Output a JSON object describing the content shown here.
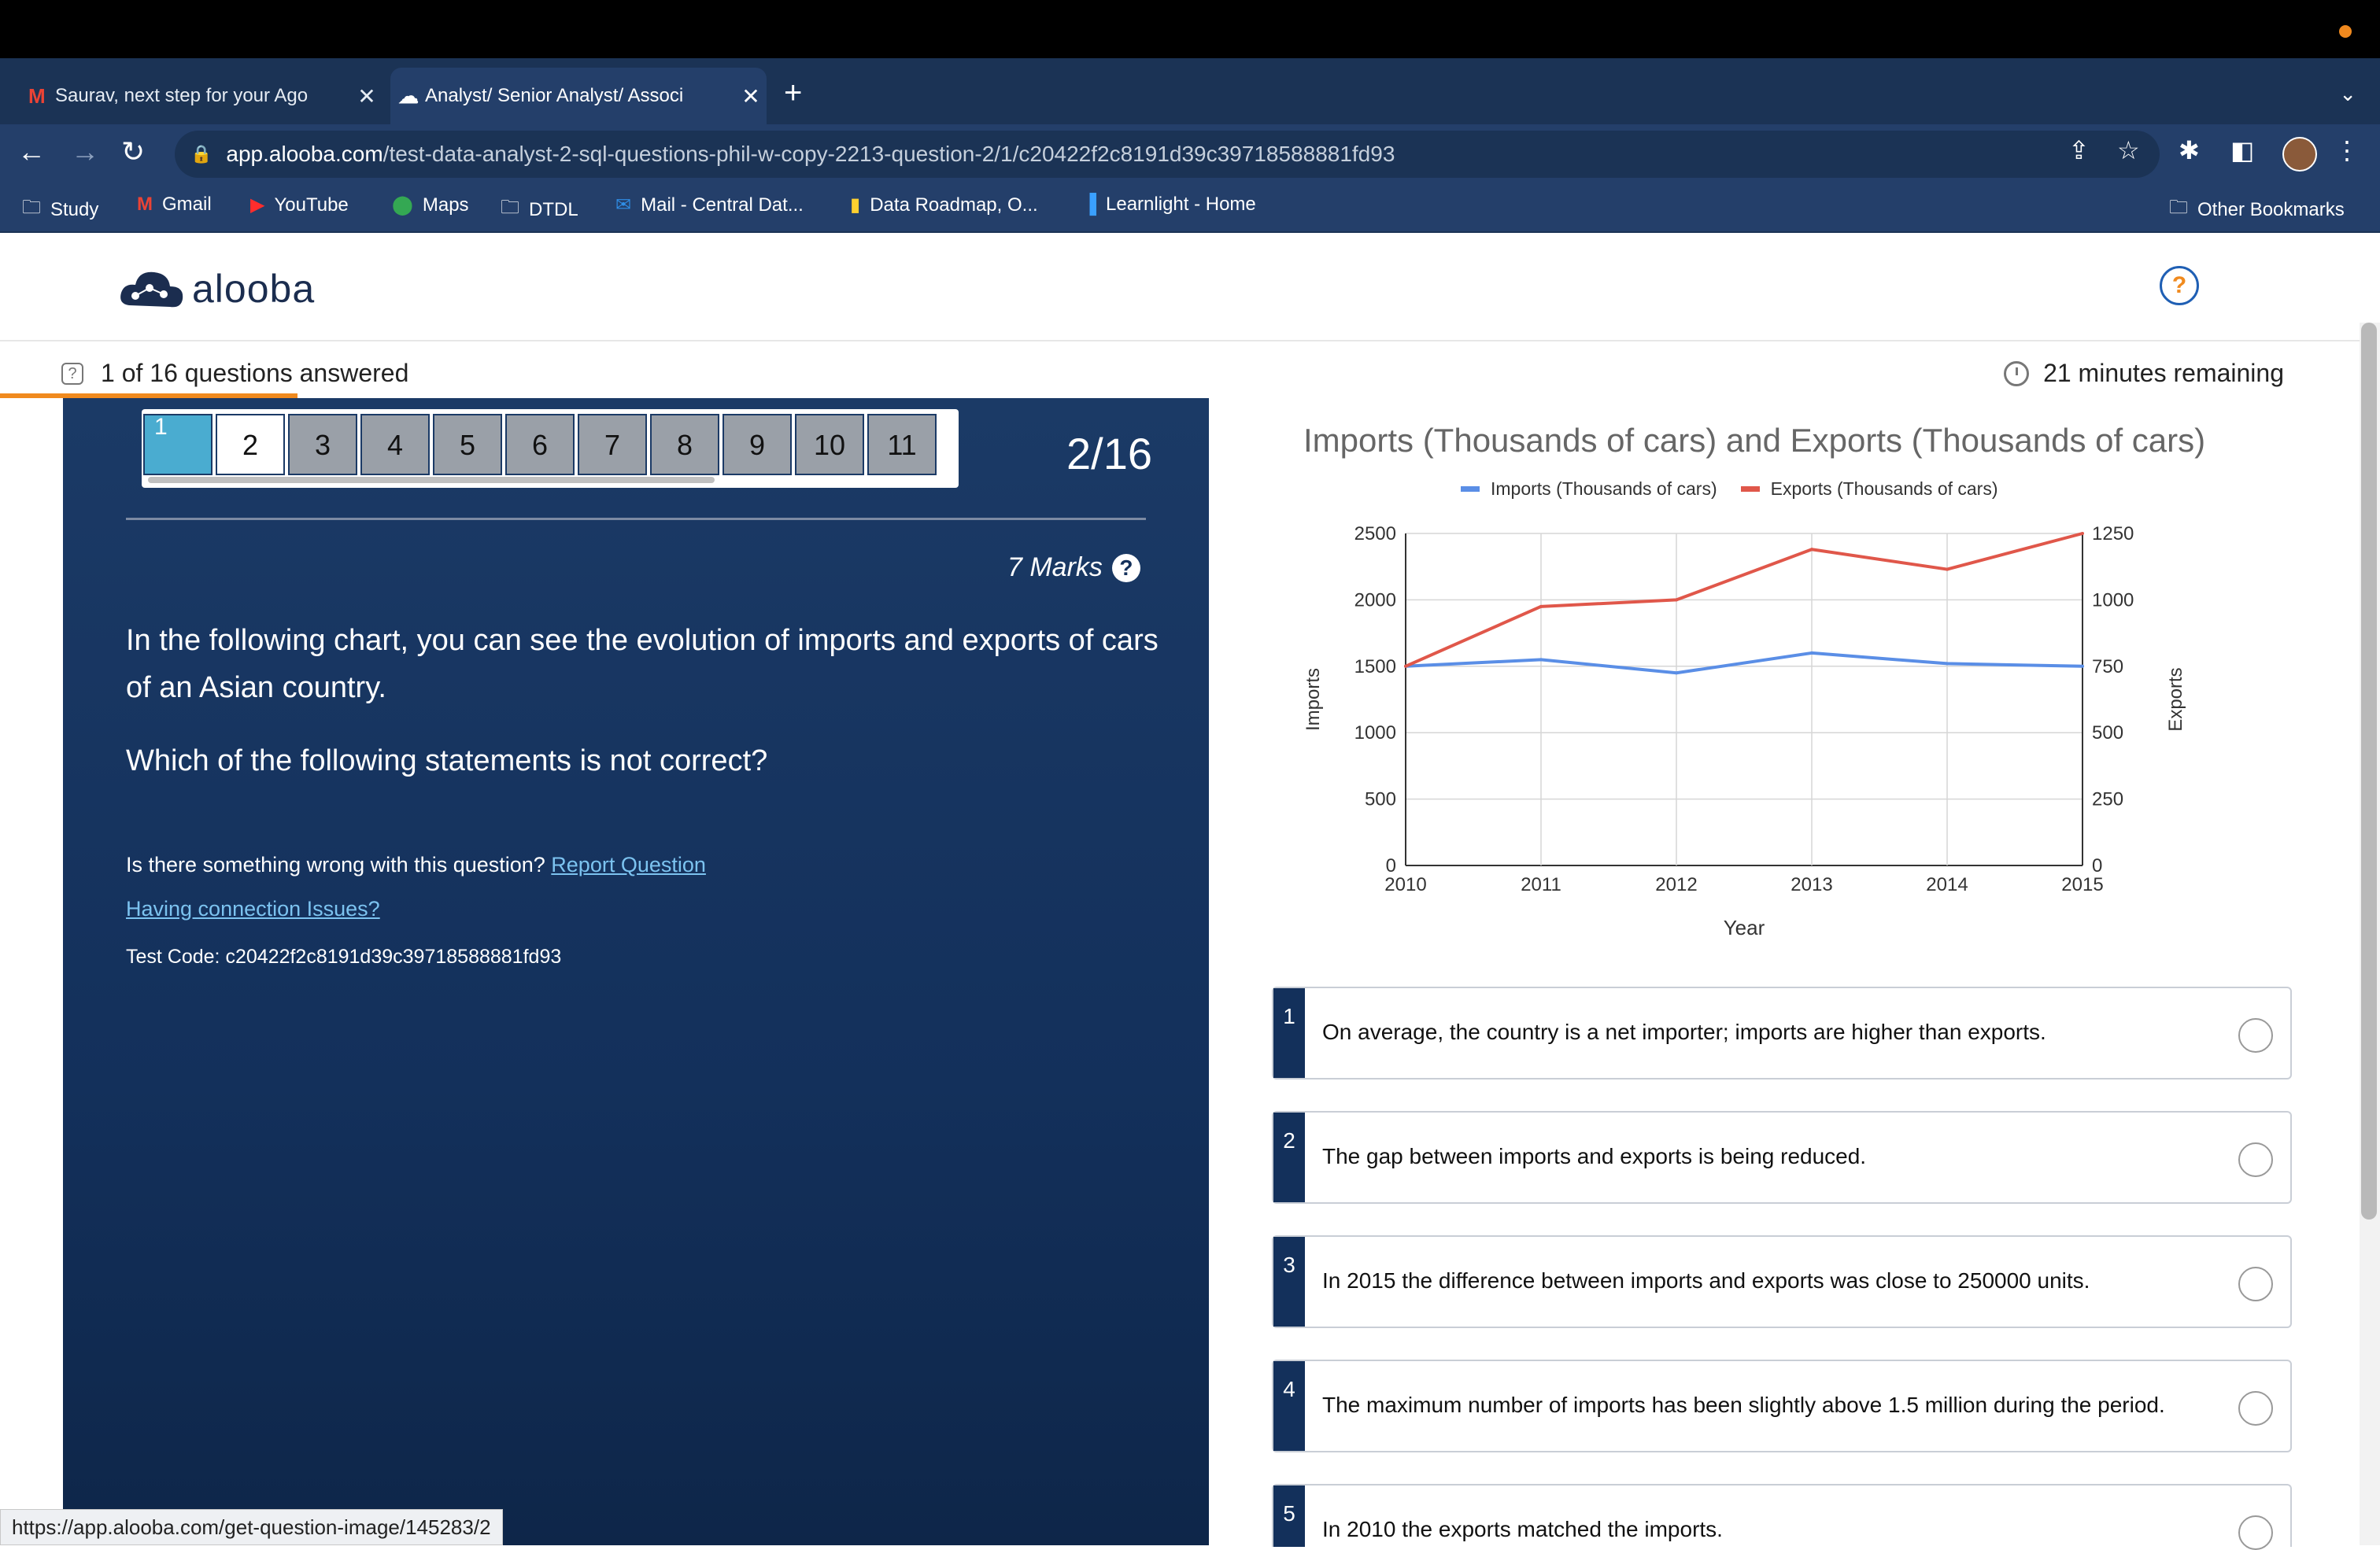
{
  "browser": {
    "tabs": [
      {
        "label": "Saurav, next step for your Ago",
        "icon": "gmail-icon"
      },
      {
        "label": "Analyst/ Senior Analyst/ Associ",
        "icon": "alooba-icon"
      }
    ],
    "url_host": "app.alooba.com",
    "url_path": "/test-data-analyst-2-sql-questions-phil-w-copy-2213-question-2/1/c20422f2c8191d39c39718588881fd93",
    "bookmarks": [
      {
        "label": "Study",
        "icon": "folder-icon"
      },
      {
        "label": "Gmail",
        "icon": "gmail-icon"
      },
      {
        "label": "YouTube",
        "icon": "youtube-icon"
      },
      {
        "label": "Maps",
        "icon": "maps-icon"
      },
      {
        "label": "DTDL",
        "icon": "folder-icon"
      },
      {
        "label": "Mail - Central Dat...",
        "icon": "outlook-icon"
      },
      {
        "label": "Data Roadmap, O...",
        "icon": "miro-icon"
      },
      {
        "label": "Learnlight - Home",
        "icon": "learnlight-icon"
      }
    ],
    "other_bookmarks": "Other Bookmarks",
    "status_url": "https://app.alooba.com/get-question-image/145283/2"
  },
  "app": {
    "logo_text": "alooba",
    "help": "?"
  },
  "progress": {
    "answered": "1 of 16 questions answered",
    "remaining": "21 minutes remaining",
    "fraction": 0.125
  },
  "question": {
    "nav_numbers": [
      "1",
      "2",
      "3",
      "4",
      "5",
      "6",
      "7",
      "8",
      "9",
      "10",
      "11"
    ],
    "counter": "2/16",
    "marks": "7 Marks",
    "text": "In the following chart, you can see the evolution of imports and exports of cars of an Asian country.",
    "prompt": "Which of the following statements is not correct?",
    "report_prefix": "Is there something wrong with this question? ",
    "report_link": "Report Question",
    "connection": "Having connection Issues?",
    "test_code": "Test Code: c20422f2c8191d39c39718588881fd93"
  },
  "chart_data": {
    "type": "line",
    "title": "Imports (Thousands of cars) and Exports (Thousands of cars)",
    "xlabel": "Year",
    "ylabel_left": "Imports",
    "ylabel_right": "Exports",
    "x": [
      2010,
      2011,
      2012,
      2013,
      2014,
      2015
    ],
    "ylim_left": [
      0,
      2500
    ],
    "ylim_right": [
      0,
      1250
    ],
    "yticks_left": [
      "0",
      "500",
      "1000",
      "1500",
      "2000",
      "2500"
    ],
    "yticks_right": [
      "0",
      "250",
      "500",
      "750",
      "1000",
      "1250"
    ],
    "series": [
      {
        "name": "Imports (Thousands of cars)",
        "axis": "left",
        "color": "#5a8ee6",
        "values": [
          1500,
          1550,
          1450,
          1600,
          1520,
          1500
        ]
      },
      {
        "name": "Exports (Thousands of cars)",
        "axis": "right",
        "color": "#e0574a",
        "values": [
          750,
          975,
          1000,
          1190,
          1115,
          1250
        ]
      }
    ],
    "grid": true,
    "legend": "top"
  },
  "options": [
    {
      "num": "1",
      "text": "On average, the country is a net importer; imports are higher than exports."
    },
    {
      "num": "2",
      "text": "The gap between imports and exports is being reduced."
    },
    {
      "num": "3",
      "text": "In 2015 the difference between imports and exports was close to 250000 units."
    },
    {
      "num": "4",
      "text": "The maximum number of imports has been slightly above 1.5 million during the period."
    },
    {
      "num": "5",
      "text": "In 2010 the exports matched the imports."
    }
  ]
}
